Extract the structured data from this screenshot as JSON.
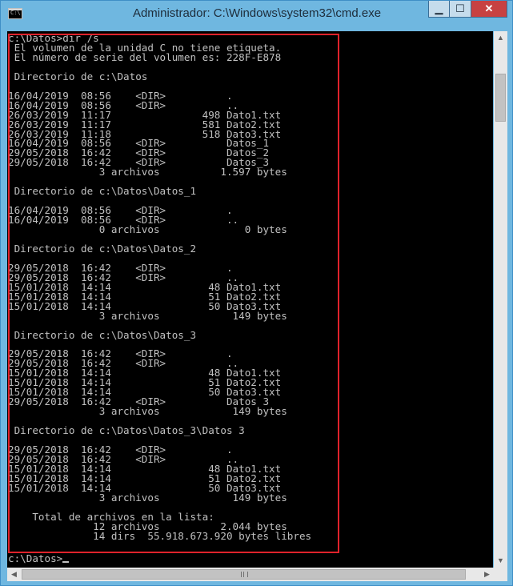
{
  "window": {
    "title": "Administrador: C:\\Windows\\system32\\cmd.exe",
    "icon_label": "C:\\.",
    "controls": {
      "minimize": "▁",
      "maximize": "☐",
      "close": "✕"
    }
  },
  "console": {
    "output": "c:\\Datos>dir /s\n El volumen de la unidad C no tiene etiqueta.\n El número de serie del volumen es: 228F-E878\n\n Directorio de c:\\Datos\n\n16/04/2019  08:56    <DIR>          .\n16/04/2019  08:56    <DIR>          ..\n26/03/2019  11:17               498 Dato1.txt\n26/03/2019  11:17               581 Dato2.txt\n26/03/2019  11:18               518 Dato3.txt\n16/04/2019  08:56    <DIR>          Datos_1\n29/05/2018  16:42    <DIR>          Datos_2\n29/05/2018  16:42    <DIR>          Datos_3\n               3 archivos          1.597 bytes\n\n Directorio de c:\\Datos\\Datos_1\n\n16/04/2019  08:56    <DIR>          .\n16/04/2019  08:56    <DIR>          ..\n               0 archivos              0 bytes\n\n Directorio de c:\\Datos\\Datos_2\n\n29/05/2018  16:42    <DIR>          .\n29/05/2018  16:42    <DIR>          ..\n15/01/2018  14:14                48 Dato1.txt\n15/01/2018  14:14                51 Dato2.txt\n15/01/2018  14:14                50 Dato3.txt\n               3 archivos            149 bytes\n\n Directorio de c:\\Datos\\Datos_3\n\n29/05/2018  16:42    <DIR>          .\n29/05/2018  16:42    <DIR>          ..\n15/01/2018  14:14                48 Dato1.txt\n15/01/2018  14:14                51 Dato2.txt\n15/01/2018  14:14                50 Dato3.txt\n29/05/2018  16:42    <DIR>          Datos 3\n               3 archivos            149 bytes\n\n Directorio de c:\\Datos\\Datos_3\\Datos 3\n\n29/05/2018  16:42    <DIR>          .\n29/05/2018  16:42    <DIR>          ..\n15/01/2018  14:14                48 Dato1.txt\n15/01/2018  14:14                51 Dato2.txt\n15/01/2018  14:14                50 Dato3.txt\n               3 archivos            149 bytes\n\n    Total de archivos en la lista:\n              12 archivos          2.044 bytes\n              14 dirs  55.918.673.920 bytes libres",
    "prompt": "c:\\Datos>"
  },
  "scrollbars": {
    "up_arrow": "▲",
    "down_arrow": "▼",
    "left_arrow": "◀",
    "right_arrow": "▶"
  },
  "colors": {
    "console_bg": "#000000",
    "console_text": "#c0c0c0",
    "frame": "#6fb7e0",
    "highlight_box": "#e0222b",
    "close_button": "#c74142"
  }
}
